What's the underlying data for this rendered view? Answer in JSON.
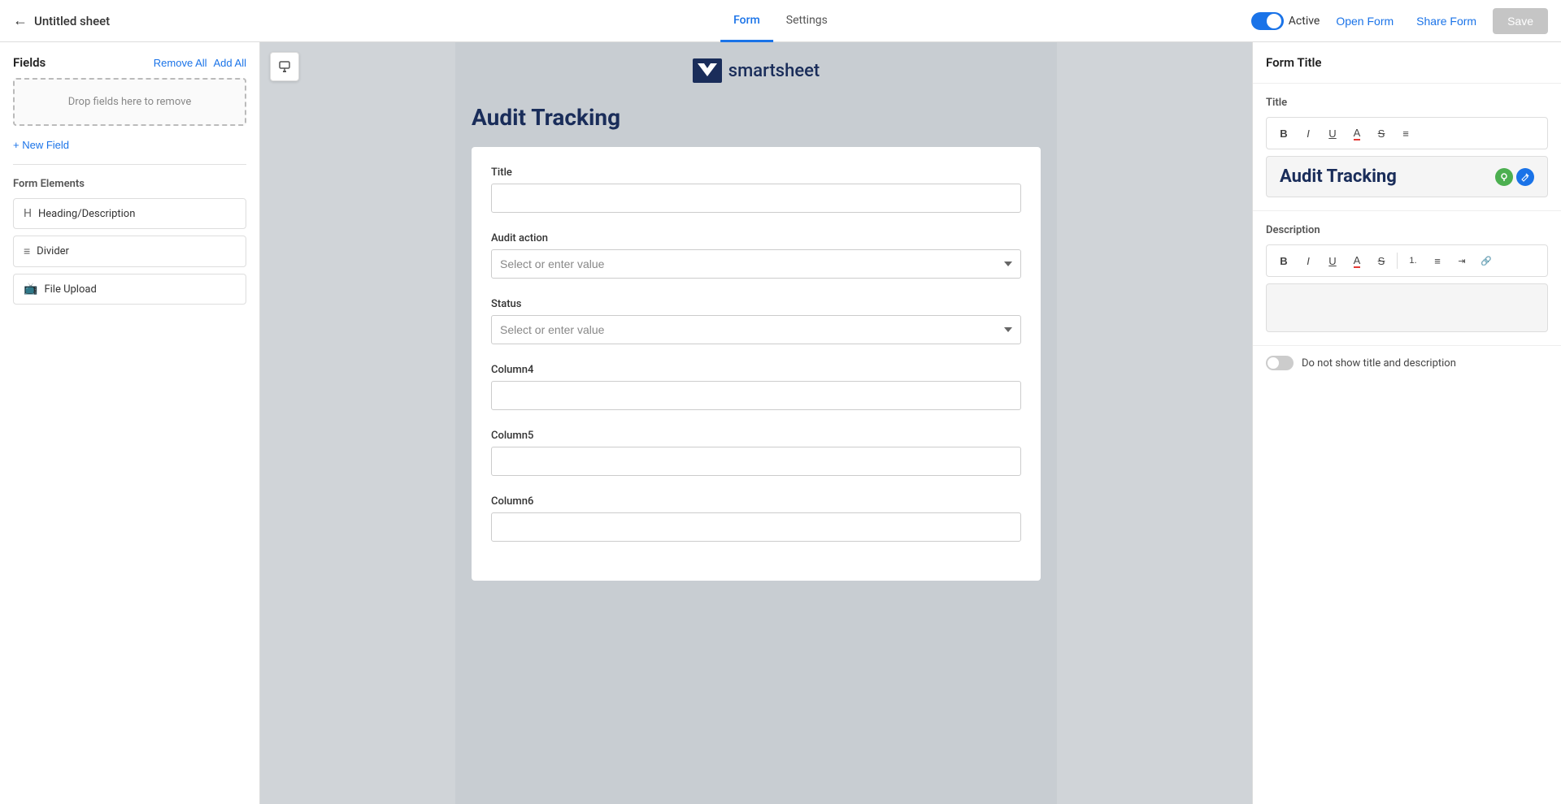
{
  "app": {
    "sheet_title": "Untitled sheet",
    "back_label": "←"
  },
  "top_nav": {
    "tabs": [
      {
        "id": "form",
        "label": "Form",
        "active": true
      },
      {
        "id": "settings",
        "label": "Settings",
        "active": false
      }
    ],
    "toggle_active": true,
    "active_label": "Active",
    "open_form_label": "Open Form",
    "share_form_label": "Share Form",
    "save_label": "Save"
  },
  "left_panel": {
    "fields_title": "Fields",
    "remove_all_label": "Remove All",
    "add_all_label": "Add All",
    "drop_zone_text": "Drop fields here to remove",
    "new_field_label": "+ New Field",
    "form_elements_title": "Form Elements",
    "elements": [
      {
        "id": "heading",
        "icon": "H",
        "label": "Heading/Description"
      },
      {
        "id": "divider",
        "icon": "≡",
        "label": "Divider"
      },
      {
        "id": "file-upload",
        "icon": "📎",
        "label": "File Upload"
      }
    ]
  },
  "form_preview": {
    "logo_text": "smartsheet",
    "title": "Audit Tracking",
    "fields": [
      {
        "id": "title",
        "label": "Title",
        "type": "text",
        "placeholder": ""
      },
      {
        "id": "audit-action",
        "label": "Audit action",
        "type": "select",
        "placeholder": "Select or enter value"
      },
      {
        "id": "status",
        "label": "Status",
        "type": "select",
        "placeholder": "Select or enter value"
      },
      {
        "id": "column4",
        "label": "Column4",
        "type": "text",
        "placeholder": ""
      },
      {
        "id": "column5",
        "label": "Column5",
        "type": "text",
        "placeholder": ""
      },
      {
        "id": "column6",
        "label": "Column6",
        "type": "text",
        "placeholder": ""
      }
    ]
  },
  "right_panel": {
    "header": "Form Title",
    "title_section": {
      "label": "Title",
      "format_buttons": [
        "B",
        "I",
        "U",
        "A",
        "S",
        "≡"
      ],
      "preview_text": "Audit Tracking"
    },
    "description_section": {
      "label": "Description",
      "format_buttons": [
        "B",
        "I",
        "U",
        "A",
        "S",
        "1.",
        "≡",
        "↗"
      ]
    },
    "toggle_label": "Do not show title and description"
  }
}
